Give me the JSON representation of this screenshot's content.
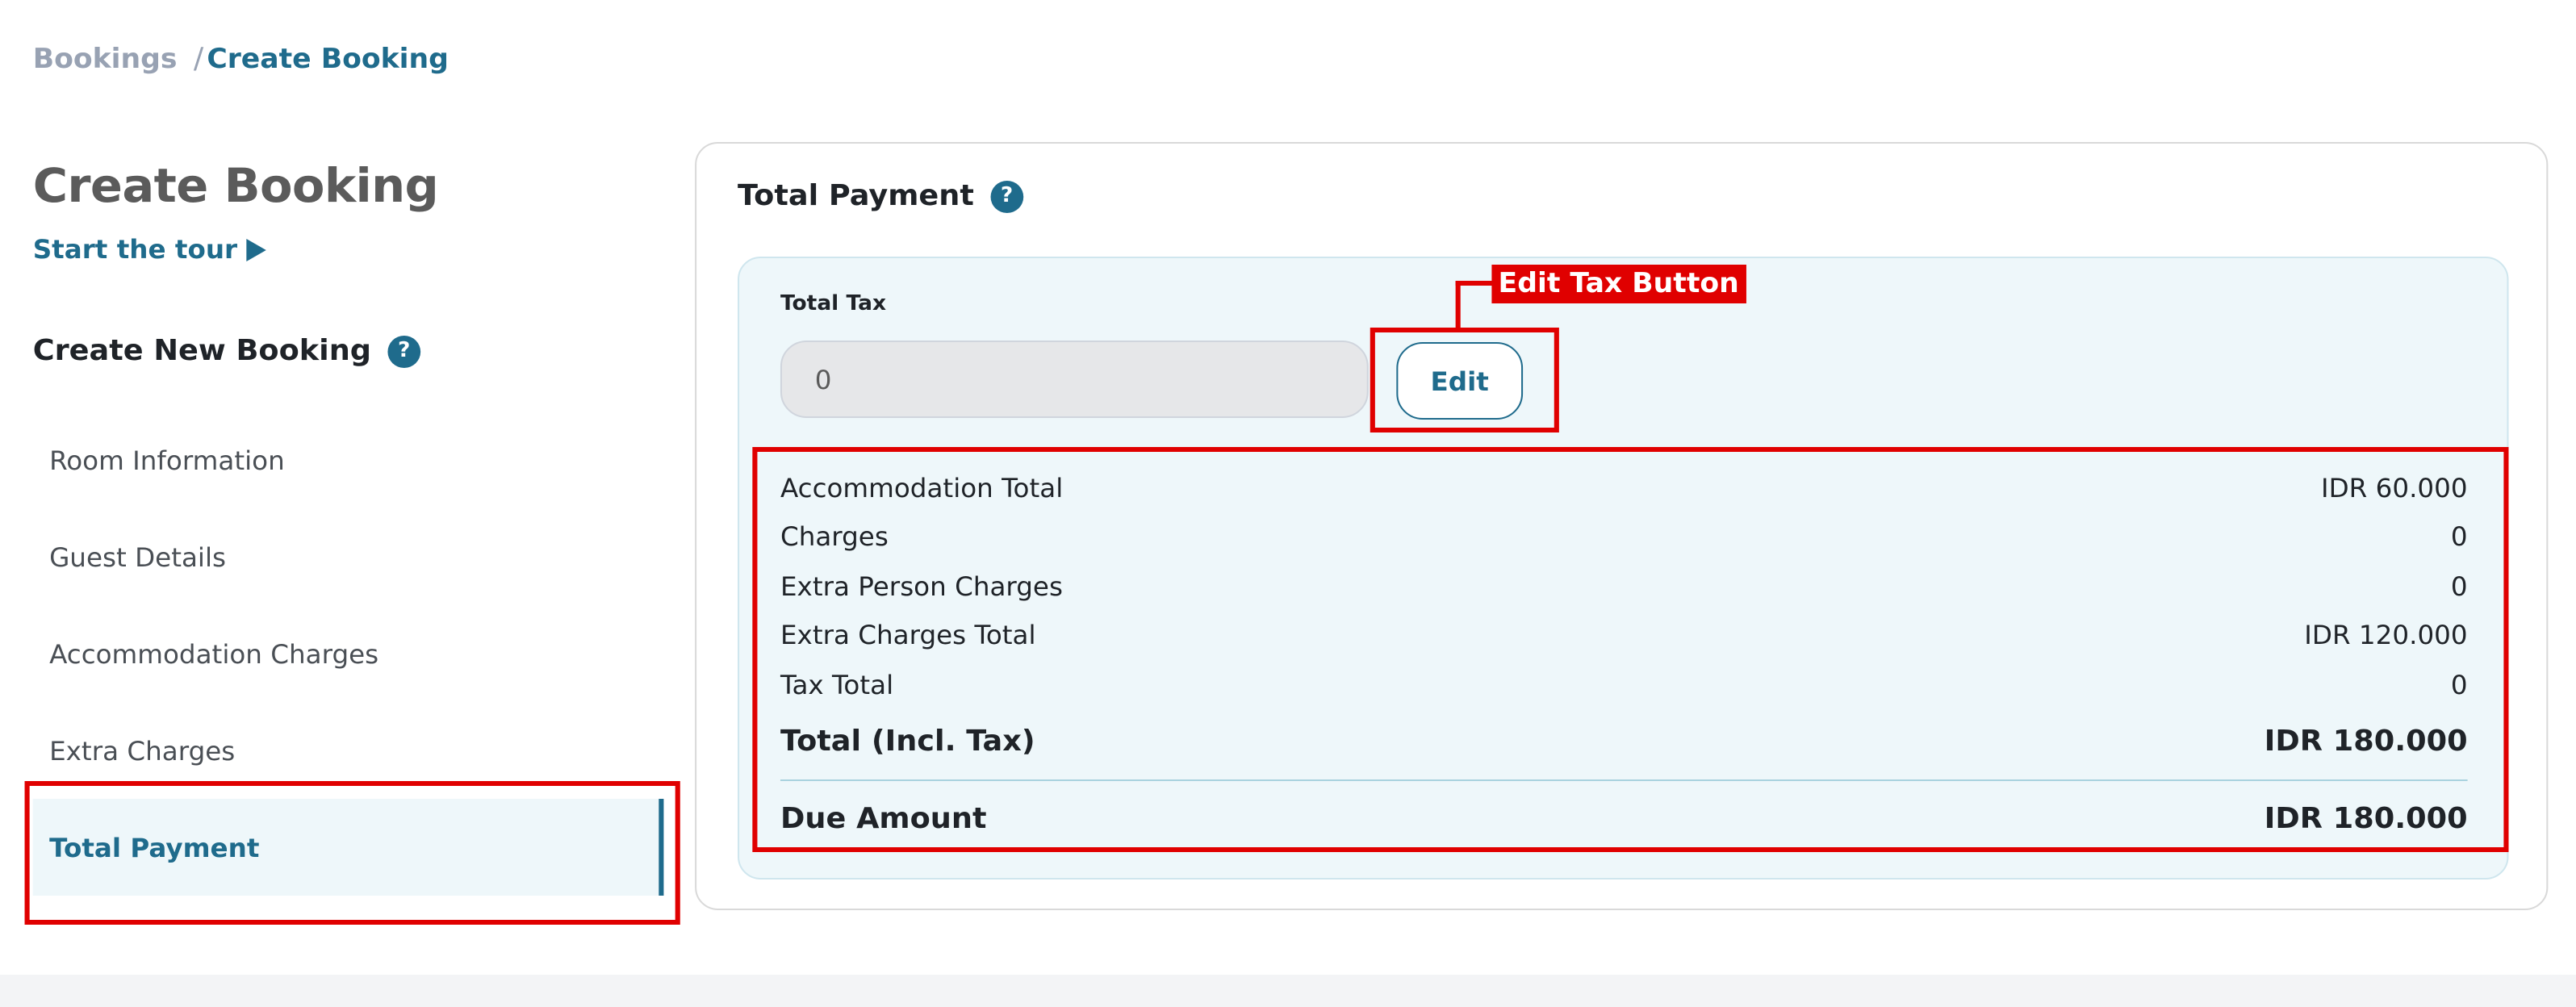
{
  "breadcrumb": {
    "parent": "Bookings",
    "separator": "/",
    "current": "Create Booking"
  },
  "page": {
    "title": "Create Booking",
    "tour_link": "Start the tour"
  },
  "sidebar": {
    "section_title": "Create New Booking",
    "items": [
      {
        "label": "Room Information"
      },
      {
        "label": "Guest Details"
      },
      {
        "label": "Accommodation Charges"
      },
      {
        "label": "Extra Charges"
      },
      {
        "label": "Total Payment"
      }
    ],
    "active_index": 4
  },
  "card": {
    "title": "Total Payment",
    "tax": {
      "label": "Total Tax",
      "value": "0",
      "edit_label": "Edit"
    },
    "rows": [
      {
        "label": "Accommodation Total",
        "value": "IDR 60.000"
      },
      {
        "label": "Charges",
        "value": "0"
      },
      {
        "label": "Extra Person Charges",
        "value": "0"
      },
      {
        "label": "Extra Charges Total",
        "value": "IDR 120.000"
      },
      {
        "label": "Tax Total",
        "value": "0"
      }
    ],
    "total": {
      "label": "Total (Incl. Tax)",
      "value": "IDR 180.000"
    },
    "due": {
      "label": "Due Amount",
      "value": "IDR 180.000"
    }
  },
  "annotations": {
    "edit_tax_label": "Edit Tax Button"
  },
  "colors": {
    "accent": "#1f6b8c",
    "highlight_bg": "#eef7fa",
    "annotation": "#e00000"
  },
  "icons": {
    "help": "question-circle-icon",
    "play": "play-triangle-icon"
  }
}
